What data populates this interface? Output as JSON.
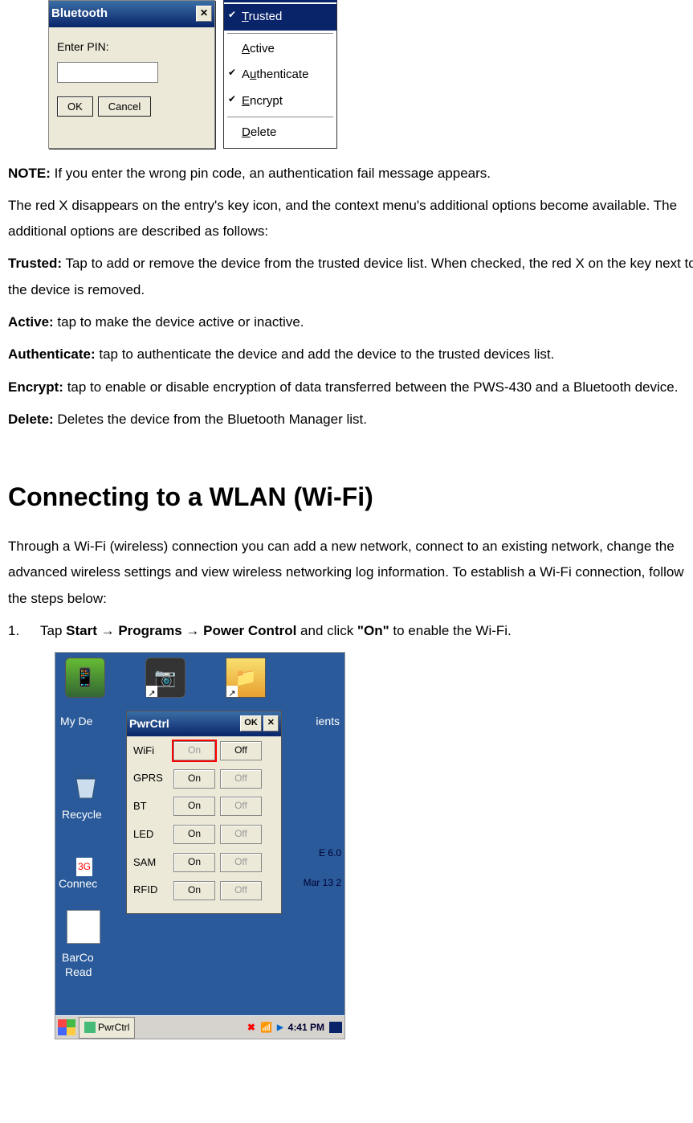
{
  "bt_dialog": {
    "title": "Bluetooth",
    "label": "Enter PIN:",
    "ok": "OK",
    "cancel": "Cancel"
  },
  "ctx": {
    "trusted": "Trusted",
    "active": "Active",
    "authenticate": "Authenticate",
    "encrypt": "Encrypt",
    "delete": "Delete"
  },
  "note": {
    "prefix": "NOTE:",
    "text": " If you enter the wrong pin code, an authentication fail message appears."
  },
  "para1": "The red X disappears on the entry's key icon, and the context menu's additional options become available. The additional options are described as follows:",
  "opts": {
    "trusted_h": "Trusted:",
    "trusted_t": " Tap to add or remove the device from the trusted device list. When checked, the red X on the key next to the device is removed.",
    "active_h": "Active:",
    "active_t": " tap to make the device active or inactive.",
    "auth_h": "Authenticate:",
    "auth_t": " tap to authenticate the device and add the device to the trusted devices list.",
    "encrypt_h": "Encrypt:",
    "encrypt_t": " tap to enable or disable encryption of data transferred between the PWS-430 and a Bluetooth device.",
    "delete_h": "Delete:",
    "delete_t": " Deletes the device from the Bluetooth Manager list."
  },
  "section_title": "Connecting to a WLAN (Wi-Fi)",
  "section_para": "Through a Wi-Fi (wireless) connection you can add a new network, connect to an existing network, change the advanced wireless settings and view wireless networking log information. To establish a Wi-Fi connection, follow the steps below:",
  "step1": {
    "num": "1.",
    "a": "Tap ",
    "b": "Start",
    "arrow1": " → ",
    "c": "Programs",
    "arrow2": " → ",
    "d": "Power Control",
    "e": " and click ",
    "f": "\"On\"",
    "g": " to enable the Wi-Fi."
  },
  "pwr": {
    "title": "PwrCtrl",
    "ok": "OK",
    "rows": [
      {
        "label": "WiFi",
        "on": "On",
        "off": "Off",
        "on_disabled": true,
        "off_disabled": false,
        "on_red": true
      },
      {
        "label": "GPRS",
        "on": "On",
        "off": "Off",
        "on_disabled": false,
        "off_disabled": true
      },
      {
        "label": "BT",
        "on": "On",
        "off": "Off",
        "on_disabled": false,
        "off_disabled": true
      },
      {
        "label": "LED",
        "on": "On",
        "off": "Off",
        "on_disabled": false,
        "off_disabled": true
      },
      {
        "label": "SAM",
        "on": "On",
        "off": "Off",
        "on_disabled": false,
        "off_disabled": true
      },
      {
        "label": "RFID",
        "on": "On",
        "off": "Off",
        "on_disabled": false,
        "off_disabled": true
      }
    ],
    "desk": {
      "my_de": "My De",
      "ients": "ients",
      "recycle": "Recycle",
      "e60": "E 6.0",
      "mar": "Mar 13 2",
      "g3": "3G",
      "connec": "Connec",
      "barco": "BarCo",
      "read": "Read"
    },
    "taskbar": {
      "app": "PwrCtrl",
      "time": "4:41 PM"
    }
  }
}
